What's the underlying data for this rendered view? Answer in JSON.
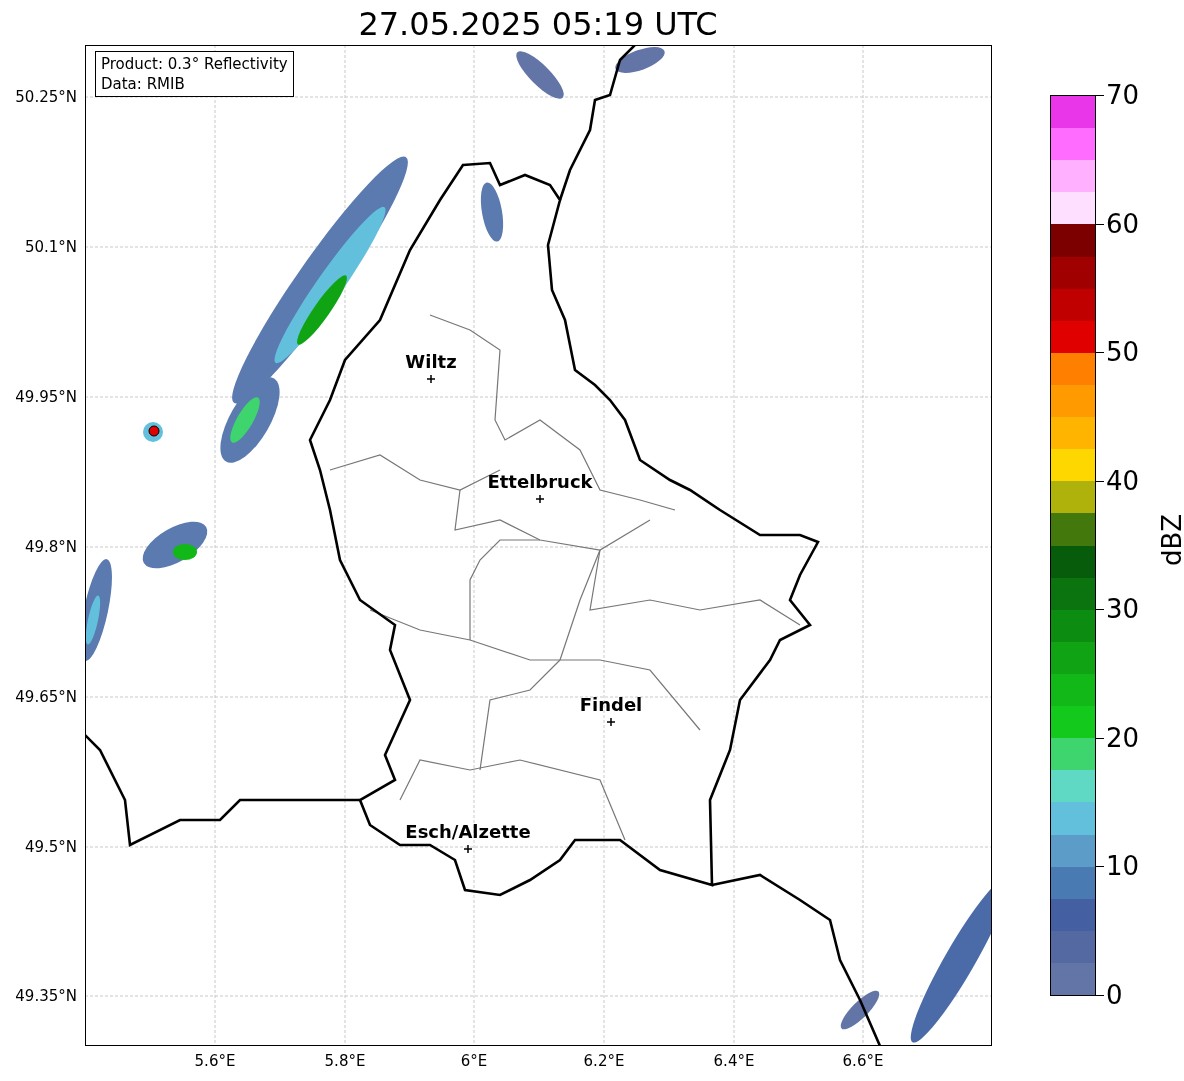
{
  "title": "27.05.2025 05:19 UTC",
  "info_box": [
    "Product: 0.3° Reflectivity",
    "Data: RMIB"
  ],
  "map": {
    "cities": [
      {
        "name": "Wiltz"
      },
      {
        "name": "Ettelbruck"
      },
      {
        "name": "Findel"
      },
      {
        "name": "Esch/Alzette"
      }
    ],
    "lat_ticks": [
      "50.25°N",
      "50.1°N",
      "49.95°N",
      "49.8°N",
      "49.65°N",
      "49.5°N",
      "49.35°N"
    ],
    "lon_ticks": [
      "5.6°E",
      "5.8°E",
      "6°E",
      "6.2°E",
      "6.4°E",
      "6.6°E"
    ]
  },
  "colorbar": {
    "label": "dBZ",
    "ticks": [
      "70",
      "60",
      "50",
      "40",
      "30",
      "20",
      "10",
      "0"
    ],
    "bands": [
      {
        "color": "#e836e8"
      },
      {
        "color": "#ff6cff"
      },
      {
        "color": "#ffb0ff"
      },
      {
        "color": "#ffdfff"
      },
      {
        "color": "#7c0000"
      },
      {
        "color": "#a00000"
      },
      {
        "color": "#c00000"
      },
      {
        "color": "#e00000"
      },
      {
        "color": "#ff7f00"
      },
      {
        "color": "#ff9a00"
      },
      {
        "color": "#ffb400"
      },
      {
        "color": "#ffd700"
      },
      {
        "color": "#aeb20a"
      },
      {
        "color": "#43780c"
      },
      {
        "color": "#075c0c"
      },
      {
        "color": "#0b740f"
      },
      {
        "color": "#0d8c12"
      },
      {
        "color": "#10a414"
      },
      {
        "color": "#12b818"
      },
      {
        "color": "#13c91c"
      },
      {
        "color": "#3ed46e"
      },
      {
        "color": "#5fd8c4"
      },
      {
        "color": "#63c0dc"
      },
      {
        "color": "#5b9dc8"
      },
      {
        "color": "#4a7ab2"
      },
      {
        "color": "#455fa3"
      },
      {
        "color": "#5468a2"
      },
      {
        "color": "#6374a6"
      }
    ]
  }
}
